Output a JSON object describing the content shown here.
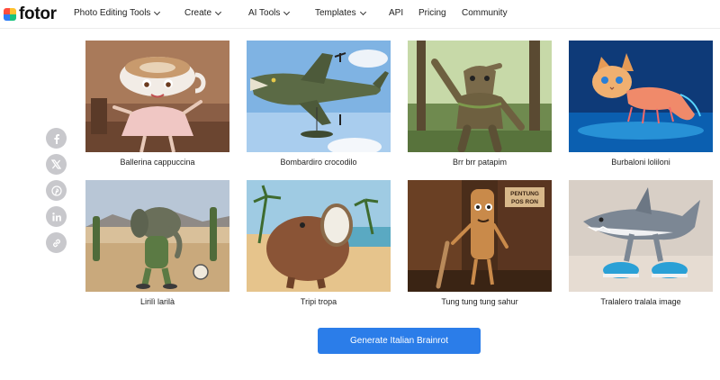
{
  "brand": {
    "name": "fotor"
  },
  "nav": {
    "items": [
      {
        "label": "Photo Editing Tools",
        "has_dropdown": true
      },
      {
        "label": "Create",
        "has_dropdown": true
      },
      {
        "label": "AI Tools",
        "has_dropdown": true
      },
      {
        "label": "Templates",
        "has_dropdown": true
      },
      {
        "label": "API",
        "has_dropdown": false
      },
      {
        "label": "Pricing",
        "has_dropdown": false
      },
      {
        "label": "Community",
        "has_dropdown": false
      }
    ]
  },
  "share": {
    "icons": [
      "facebook-icon",
      "x-twitter-icon",
      "pinterest-icon",
      "linkedin-icon",
      "link-icon"
    ]
  },
  "gallery": {
    "items": [
      {
        "caption": "Ballerina cappuccina"
      },
      {
        "caption": "Bombardiro crocodilo"
      },
      {
        "caption": "Brr brr patapim"
      },
      {
        "caption": "Burbaloni loliloni"
      },
      {
        "caption": "Lirilì larilà"
      },
      {
        "caption": "Tripi tropa"
      },
      {
        "caption": "Tung tung tung sahur"
      },
      {
        "caption": "Tralalero tralala image"
      }
    ]
  },
  "image_text": {
    "sign": "PENTUNG POS RON"
  },
  "cta": {
    "label": "Generate Italian Brainrot"
  },
  "colors": {
    "accent": "#2b7de9",
    "share_icon_bg": "#c8c8cc"
  }
}
